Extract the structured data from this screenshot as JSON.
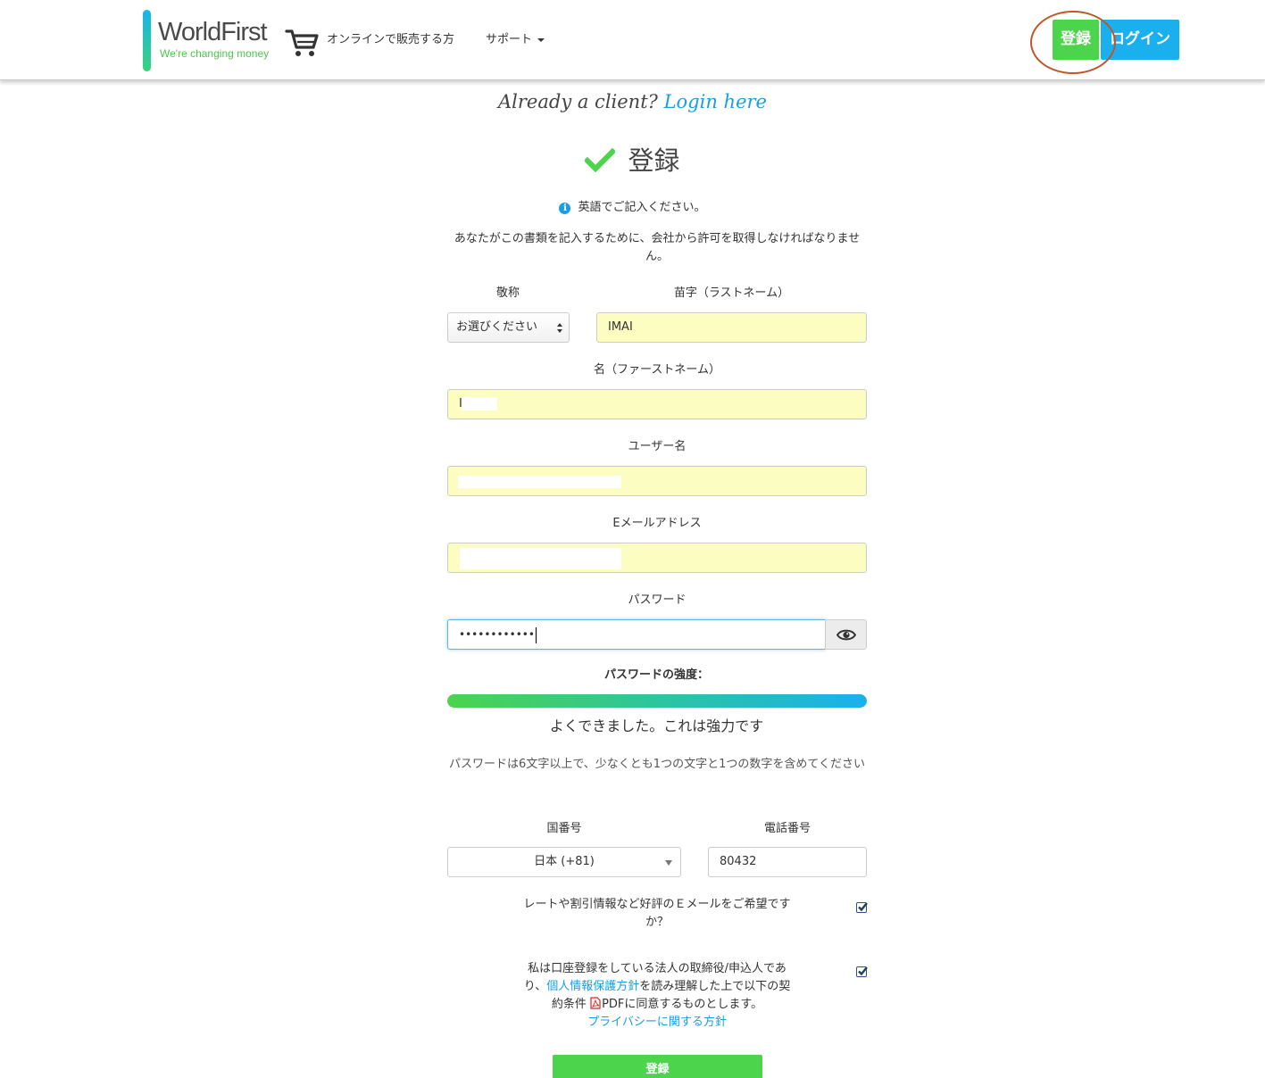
{
  "header": {
    "logo_name": "WorldFirst",
    "logo_tagline": "We're changing money",
    "nav_online": "オンラインで販売する方",
    "nav_support": "サポート",
    "register_label": "登録",
    "login_label": "ログイン"
  },
  "already": {
    "text": "Already a client?",
    "link": "Login here"
  },
  "form": {
    "title": "登録",
    "english_note": "英語でご記入ください。",
    "permission_note": "あなたがこの書類を記入するために、会社から許可を取得しなければなりません。",
    "salutation_label": "敬称",
    "salutation_value": "お選びください",
    "lastname_label": "苗字（ラストネーム）",
    "lastname_value": "IMAI",
    "firstname_label": "名（ファーストネーム）",
    "firstname_value": "I",
    "username_label": "ユーザー名",
    "email_label": "Eメールアドレス",
    "password_label": "パスワード",
    "password_value": "••••••••••••",
    "strength_label": "パスワードの強度：",
    "strength_level": 1.0,
    "strength_text": "よくできました。これは強力です",
    "password_hint": "パスワードは6文字以上で、少なくとも1つの文字と1つの数字を含めてください",
    "country_code_label": "国番号",
    "country_code_value": "日本 (+81)",
    "phone_label": "電話番号",
    "phone_value": "80432",
    "newsletter_text": "レートや割引情報など好評のＥメールをご希望ですか？",
    "newsletter_checked": true,
    "agree_text_1": "私は口座登録をしている法人の取締役/申込人であり、",
    "agree_link_privacy": "個人情報保護方針",
    "agree_text_2": "を読み理解した上で以下の契約条件",
    "agree_pdf": "PDF",
    "agree_text_3": "に同意するものとします。",
    "agree_link_policy": "プライバシーに関する方針",
    "agree_checked": true,
    "submit_label": "登録"
  },
  "colors": {
    "brand_green": "#4cd44c",
    "brand_blue": "#1ab0ee",
    "field_fill": "#fcfdc1",
    "link": "#1a9ee0"
  }
}
